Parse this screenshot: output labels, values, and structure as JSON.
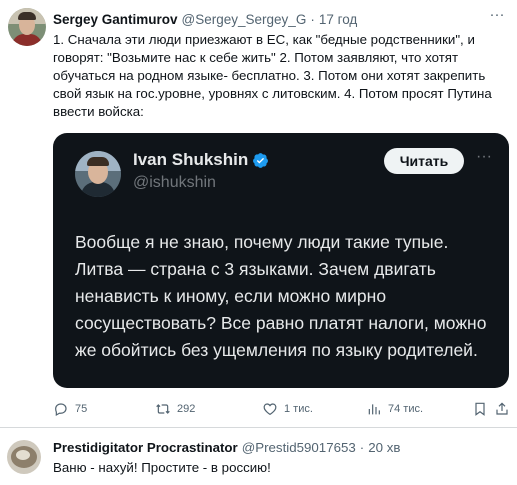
{
  "tweet": {
    "author_name": "Sergey Gantimurov",
    "author_handle": "@Sergey_Sergey_G",
    "separator": "·",
    "time": "17 год",
    "more_icon": "ellipsis-icon",
    "text": "1. Сначала эти люди приезжают в ЕС, как \"бедные родственники\", и говорят: \"Возьмите нас к себе жить\" 2. Потом заявляют, что хотят обучаться на родном языке- бесплатно. 3. Потом они хотят закрепить свой язык на гос.уровне, уровнях с литовским. 4. Потом просят Путина ввести войска:",
    "quoted": {
      "name": "Ivan Shukshin",
      "handle": "@ishukshin",
      "verified_icon": "verified-badge-icon",
      "verified_color": "#1d9bf0",
      "follow_label": "Читать",
      "more_icon": "ellipsis-icon",
      "body": "Вообще я не знаю, почему люди такие тупые. Литва — страна с 3 языками. Зачем двигать ненависть к иному, если можно мирно сосуществовать? Все равно платят налоги, можно же обойтись без ущемления по языку родителей."
    },
    "actions": {
      "replies": "75",
      "retweets": "292",
      "likes": "1 тис.",
      "views": "74 тис.",
      "reply_icon": "comment-icon",
      "retweet_icon": "retweet-icon",
      "like_icon": "heart-icon",
      "views_icon": "bar-chart-icon",
      "bookmark_icon": "bookmark-icon",
      "share_icon": "share-icon"
    }
  },
  "reply": {
    "author_name": "Prestidigitator Procrastinator",
    "author_handle": "@Prestid59017653",
    "separator": "·",
    "time": "20 хв",
    "text": "Ваню - нахуй! Простите - в россию!"
  },
  "colors": {
    "text_primary": "#0f1419",
    "text_secondary": "#536471",
    "quote_background": "#0f1419",
    "accent": "#1d9bf0"
  }
}
